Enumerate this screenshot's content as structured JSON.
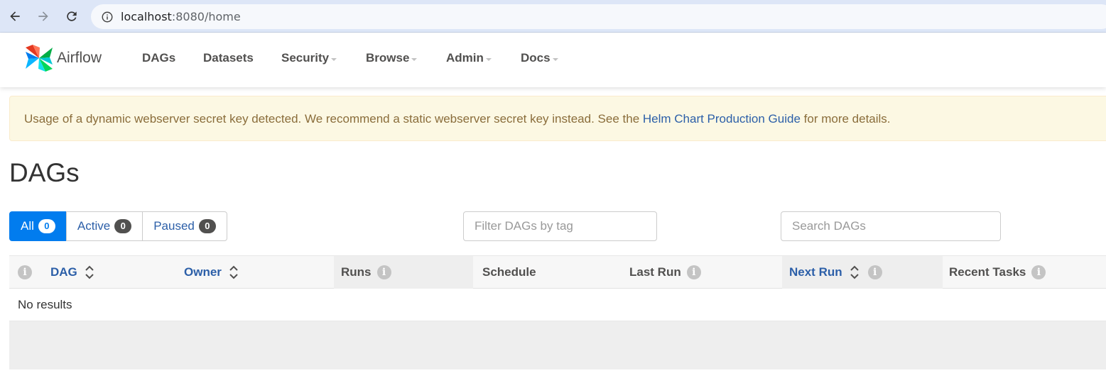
{
  "browser": {
    "url_host": "localhost",
    "url_path": ":8080/home"
  },
  "navbar": {
    "brand": "Airflow",
    "items": [
      {
        "label": "DAGs"
      },
      {
        "label": "Datasets"
      },
      {
        "label": "Security"
      },
      {
        "label": "Browse"
      },
      {
        "label": "Admin"
      },
      {
        "label": "Docs"
      }
    ]
  },
  "alert": {
    "text_before": "Usage of a dynamic webserver secret key detected. We recommend a static webserver secret key instead. See the ",
    "link_text": "Helm Chart Production Guide",
    "text_after": " for more details."
  },
  "page": {
    "title": "DAGs"
  },
  "status_filter": {
    "all": {
      "label": "All",
      "count": "0"
    },
    "active": {
      "label": "Active",
      "count": "0"
    },
    "paused": {
      "label": "Paused",
      "count": "0"
    }
  },
  "filters": {
    "tag_placeholder": "Filter DAGs by tag",
    "search_placeholder": "Search DAGs"
  },
  "table": {
    "columns": {
      "dag": "DAG",
      "owner": "Owner",
      "runs": "Runs",
      "schedule": "Schedule",
      "last_run": "Last Run",
      "next_run": "Next Run",
      "recent_tasks": "Recent Tasks"
    },
    "info_glyph": "i",
    "empty_message": "No results"
  },
  "colors": {
    "primary": "#017cee",
    "link": "#2c5fa8",
    "alert_bg": "#fcf8e3",
    "alert_text": "#8a6d3b"
  }
}
